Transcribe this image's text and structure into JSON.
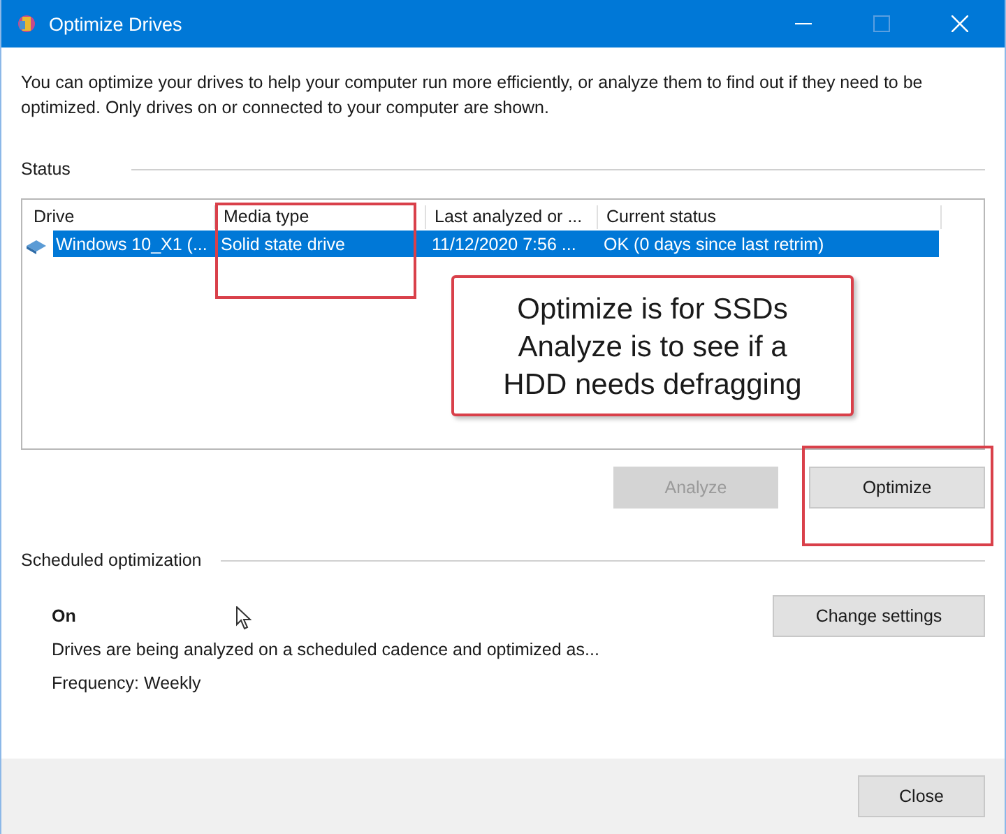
{
  "window": {
    "title": "Optimize Drives"
  },
  "description": "You can optimize your drives to help your computer run more efficiently, or analyze them to find out if they need to be optimized. Only drives on or connected to your computer are shown.",
  "status": {
    "heading": "Status",
    "columns": [
      "Drive",
      "Media type",
      "Last analyzed or ...",
      "Current status"
    ],
    "rows": [
      {
        "cells": [
          "Windows 10_X1 (...",
          "Solid state drive",
          "11/12/2020 7:56 ...",
          "OK (0 days since last retrim)"
        ],
        "selected": true
      }
    ],
    "buttons": [
      {
        "label": "Analyze",
        "disabled": true
      },
      {
        "label": "Optimize",
        "disabled": false
      }
    ]
  },
  "callout": {
    "lines": [
      "Optimize is for SSDs",
      "Analyze is to see if a",
      "HDD needs defragging"
    ]
  },
  "scheduled": {
    "heading": "Scheduled optimization",
    "state": "On",
    "description": "Drives are being analyzed on a scheduled cadence and optimized as...",
    "frequency": "Frequency: Weekly",
    "button": "Change settings"
  },
  "footer": {
    "button": "Close"
  }
}
